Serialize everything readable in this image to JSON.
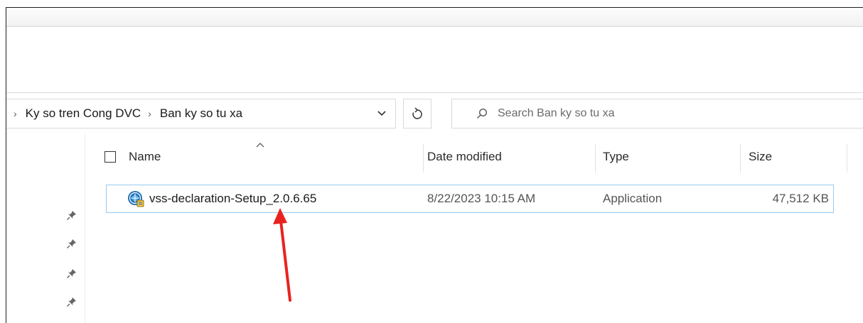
{
  "address": {
    "crumbs": [
      "Ky so tren Cong DVC",
      "Ban ky so tu xa"
    ],
    "separator": "›"
  },
  "search": {
    "placeholder": "Search Ban ky so tu xa"
  },
  "columns": {
    "name": "Name",
    "date_modified": "Date modified",
    "type": "Type",
    "size": "Size"
  },
  "files": [
    {
      "name": "vss-declaration-Setup_2.0.6.65",
      "date_modified": "8/22/2023 10:15 AM",
      "type": "Application",
      "size": "47,512 KB"
    }
  ],
  "icons": {
    "pin": "pin-icon",
    "refresh": "refresh-icon",
    "search": "search-icon",
    "dropdown": "chevron-down-icon",
    "sort": "sort-up-icon",
    "file": "application-icon",
    "annotation": "red-arrow"
  },
  "colors": {
    "selection_border": "#99c9ef",
    "annotation": "#e8231f"
  }
}
